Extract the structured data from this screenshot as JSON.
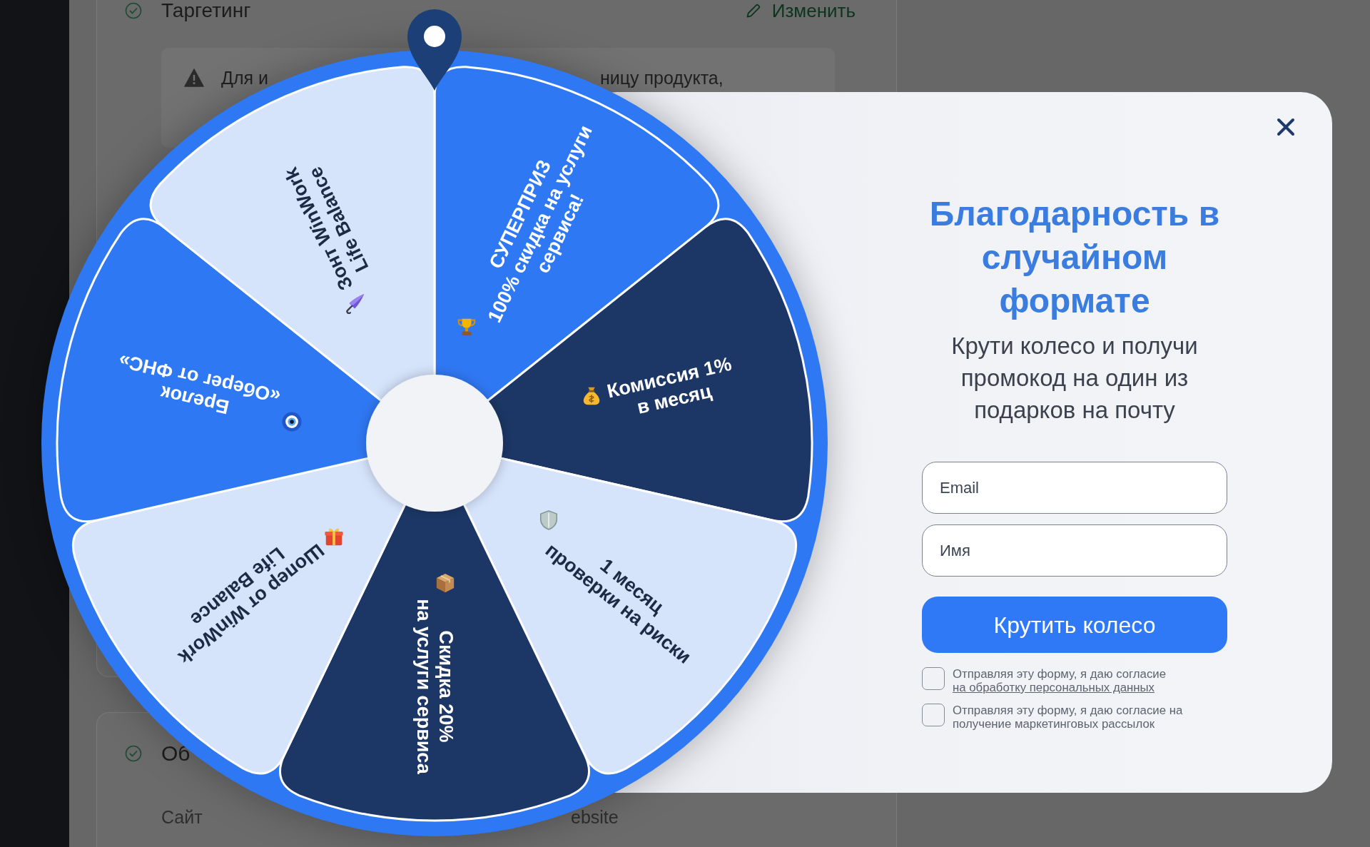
{
  "page": {
    "targeting_section": {
      "title": "Таргетинг",
      "edit_link": "Изменить",
      "notice_fragments": [
        "Для и",
        "ницу продукта,"
      ]
    },
    "second_section": {
      "title": "Об",
      "field_label": "Сайт",
      "field_value": "ebsite"
    }
  },
  "wheel": {
    "segments": [
      {
        "lines": [
          "СУПЕРПРИЗ",
          "100% скидка на услуги",
          "сервиса!"
        ],
        "color": "#2f78f4"
      },
      {
        "lines": [
          "Комиссия 1%",
          "в месяц"
        ],
        "color": "#1c3766"
      },
      {
        "lines": [
          "1 месяц",
          "проверки на риски"
        ],
        "color": "#d5e3fb"
      },
      {
        "lines": [
          "Скидка 20%",
          "на услуги сервиса"
        ],
        "color": "#1c3766"
      },
      {
        "lines": [
          "Шопер от WinWork",
          "Life Balance"
        ],
        "color": "#d5e3fb"
      },
      {
        "lines": [
          "Брелок",
          "«Оберег от ФНС»"
        ],
        "color": "#2f78f4"
      },
      {
        "lines": [
          "Зонт WinWork",
          "Life Balance"
        ],
        "color": "#d5e3fb"
      }
    ]
  },
  "popup": {
    "title": "Благодарность в\nслучайном\nформате",
    "subtitle": "Крути колесо и получи\nпромокод на один из\nподарков на почту",
    "fields": [
      {
        "placeholder": "Email"
      },
      {
        "placeholder": "Имя"
      }
    ],
    "submit_button": "Крутить колесо",
    "consents": [
      {
        "text": "Отправляя эту форму, я даю согласие",
        "link": "на обработку персональных данных",
        "checked": false
      },
      {
        "text": "Отправляя эту форму, я даю согласие на получение маркетинговых рассылок",
        "checked": false
      }
    ]
  }
}
